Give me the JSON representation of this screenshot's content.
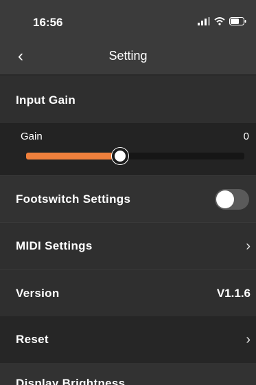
{
  "status": {
    "time": "16:56"
  },
  "nav": {
    "title": "Setting"
  },
  "input_gain": {
    "label": "Input Gain",
    "gain_label": "Gain",
    "gain_value": "0",
    "slider_fraction": 0.43
  },
  "rows": {
    "footswitch": {
      "label": "Footswitch Settings",
      "toggle_on": false
    },
    "midi": {
      "label": "MIDI Settings"
    },
    "version": {
      "label": "Version",
      "value": "V1.1.6"
    },
    "reset": {
      "label": "Reset"
    },
    "display": {
      "label": "Display Brightness"
    }
  },
  "colors": {
    "accent": "#f0803c",
    "background": "#2f2f2f"
  },
  "icons": [
    "signal-icon",
    "wifi-icon",
    "battery-icon",
    "back-chevron-icon",
    "chevron-right-icon"
  ]
}
